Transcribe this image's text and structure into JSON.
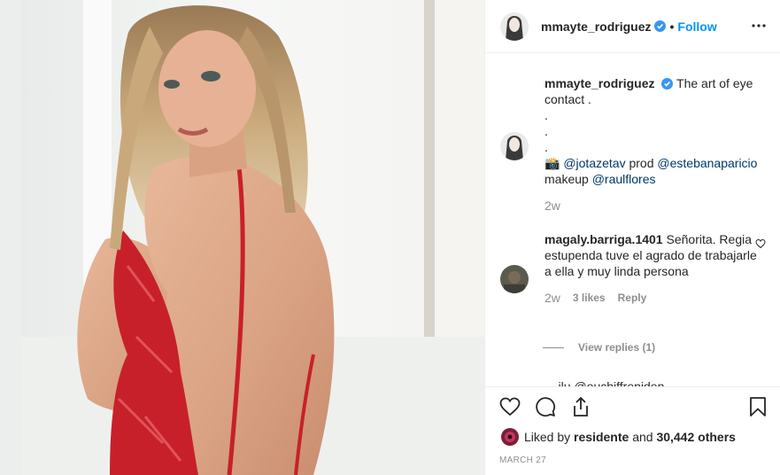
{
  "post": {
    "username": "mmayte_rodriguez",
    "verified": true,
    "separator": "•",
    "follow_label": "Follow",
    "more_icon": "more-icon"
  },
  "caption": {
    "username": "mmayte_rodriguez",
    "text_1": "The art of eye contact .",
    "dot_1": ".",
    "dot_2": ".",
    "dot_3": ".",
    "camera_emoji": "📸",
    "mention_1": "@jotazetav",
    "word_prod": "prod",
    "mention_2": "@estebanaparicio",
    "word_makeup": "makeup",
    "mention_3": "@raulflores",
    "time": "2w"
  },
  "comment": {
    "username": "magaly.barriga.1401",
    "text": "Señorita. Regia estupenda tuve el agrado de trabajarle a ella y muy linda persona",
    "time": "2w",
    "likes_label": "3 likes",
    "reply_label": "Reply",
    "view_replies_label": "View replies (1)",
    "cutoff_text": "... ilu @ouchiffreniden"
  },
  "actions": {
    "icons": [
      "heart-icon",
      "comment-icon",
      "share-icon",
      "bookmark-icon"
    ]
  },
  "likes": {
    "prefix": "Liked by",
    "user": "residente",
    "middle": "and",
    "count": "30,442 others"
  },
  "date": "MARCH 27",
  "colors": {
    "link_blue": "#0095f6",
    "mention_blue": "#00376b",
    "muted": "#8e8e8e",
    "text": "#262626",
    "dress_red": "#c8202a"
  }
}
